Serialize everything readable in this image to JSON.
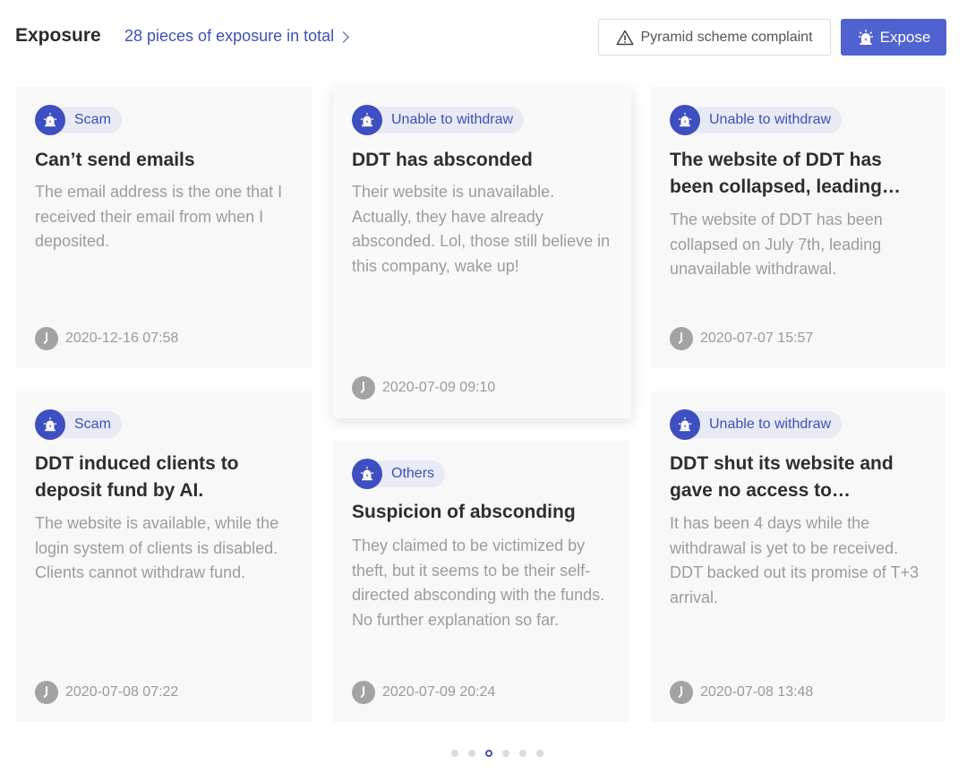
{
  "header": {
    "title": "Exposure",
    "total_link": "28 pieces of exposure in total",
    "complaint_button": "Pyramid scheme complaint",
    "expose_button": "Expose"
  },
  "cards": [
    {
      "tag": "Scam",
      "title": "Can’t send emails",
      "body": "The email address is the one that I received their email from when I deposited.",
      "time": "2020-12-16 07:58"
    },
    {
      "tag": "Unable to withdraw",
      "title": "DDT has absconded",
      "body": "Their website is unavailable. Actually, they have already absconded. Lol, those still believe in this company, wake up!",
      "time": "2020-07-09 09:10"
    },
    {
      "tag": "Unable to withdraw",
      "title": "The website of DDT has been collapsed, leading unavailable withdrawal",
      "body": "The website of DDT has been collapsed on July 7th, leading unavailable withdrawal.",
      "time": "2020-07-07 15:57"
    },
    {
      "tag": "Scam",
      "title": "DDT induced clients to deposit fund by AI.",
      "body": "The website is available, while the login system of clients is disabled. Clients cannot withdraw fund.",
      "time": "2020-07-08 07:22"
    },
    {
      "tag": "Others",
      "title": "Suspicion of absconding",
      "body": "They claimed to be victimized by theft, but it seems to be their self-directed absconding with the funds. No further explanation so far.",
      "time": "2020-07-09 20:24"
    },
    {
      "tag": "Unable to withdraw",
      "title": "DDT shut its website and gave no access to withdrawal",
      "body": "It has been 4 days while the withdrawal is yet to be received. DDT backed out its promise of T+3 arrival.",
      "time": "2020-07-08 13:48"
    }
  ],
  "pagination": {
    "total": 6,
    "active_index": 2
  },
  "colors": {
    "accent": "#3d51b8",
    "button": "#4f62cf",
    "card_bg": "#f8f8f8"
  }
}
